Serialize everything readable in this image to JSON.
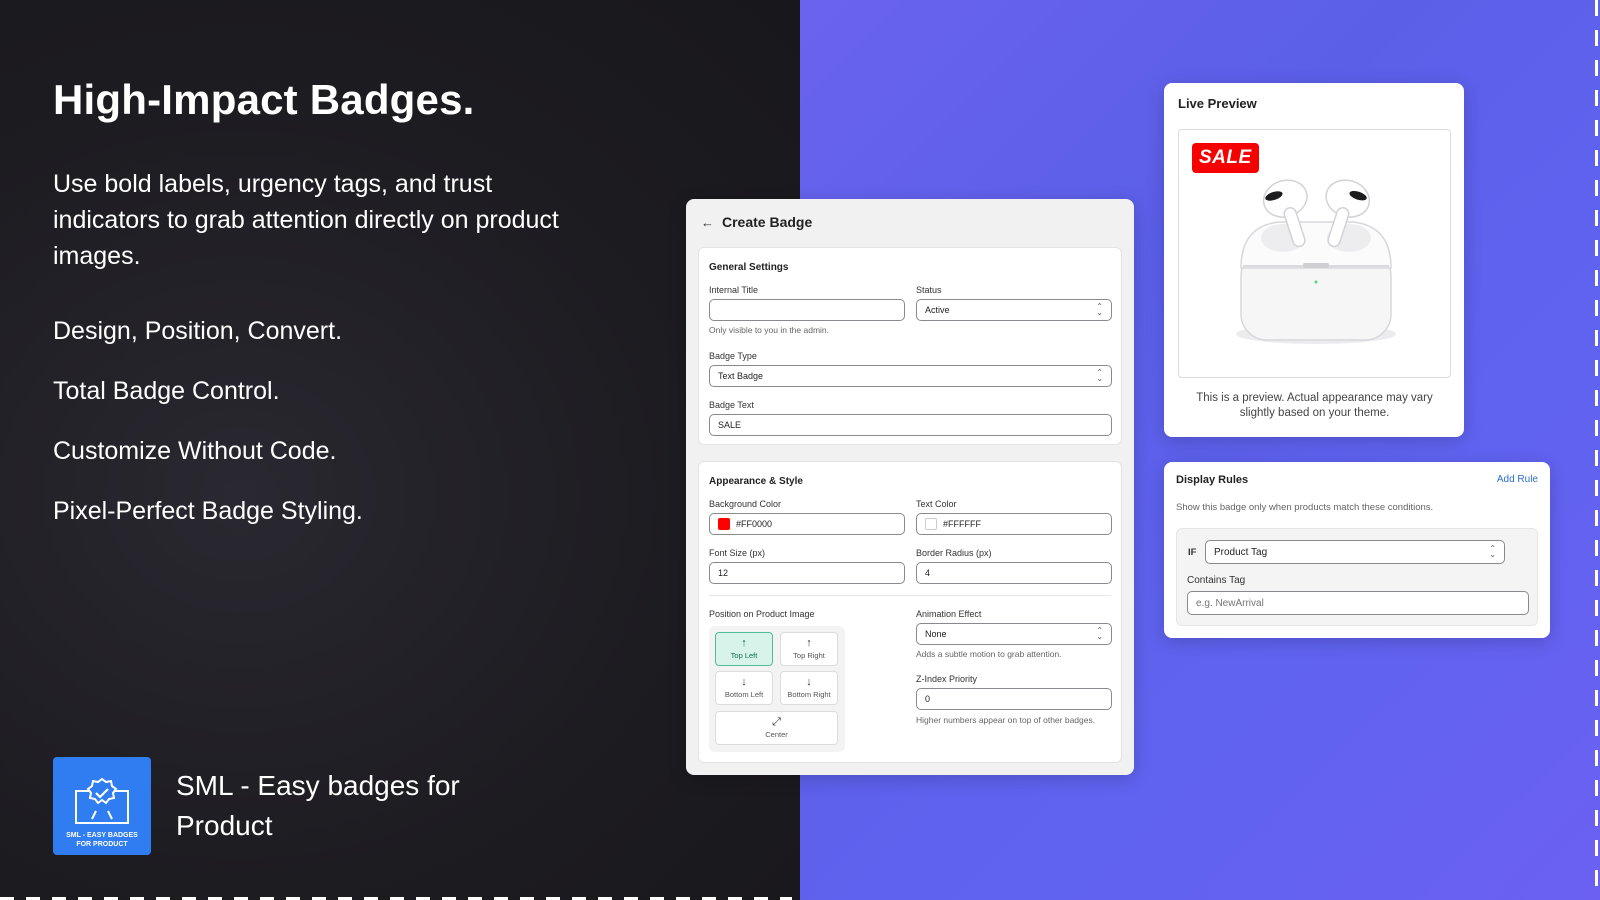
{
  "hero": {
    "title": "High-Impact Badges.",
    "description": "Use bold labels, urgency tags, and trust indicators to grab attention directly on product images.",
    "features": [
      "Design, Position, Convert.",
      "Total Badge Control.",
      "Customize Without Code.",
      "Pixel-Perfect Badge Styling."
    ]
  },
  "app": {
    "logo_text": "SML - EASY BADGES\nFOR PRODUCT",
    "name": "SML - Easy badges for Product",
    "brand_color": "#2f7df0"
  },
  "create_badge": {
    "back_icon": "arrow-left-icon",
    "title": "Create Badge",
    "general": {
      "title": "General Settings",
      "internal_title_label": "Internal Title",
      "internal_title_value": "",
      "internal_title_help": "Only visible to you in the admin.",
      "status_label": "Status",
      "status_value": "Active",
      "badge_type_label": "Badge Type",
      "badge_type_value": "Text Badge",
      "badge_text_label": "Badge Text",
      "badge_text_value": "SALE"
    },
    "appearance": {
      "title": "Appearance & Style",
      "bg_color_label": "Background Color",
      "bg_color_value": "#FF0000",
      "text_color_label": "Text Color",
      "text_color_value": "#FFFFFF",
      "font_size_label": "Font Size (px)",
      "font_size_value": "12",
      "border_radius_label": "Border Radius (px)",
      "border_radius_value": "4",
      "position_label": "Position on Product Image",
      "positions": {
        "top_left": "Top Left",
        "top_right": "Top Right",
        "bottom_left": "Bottom Left",
        "bottom_right": "Bottom Right",
        "center": "Center"
      },
      "selected_position": "Top Left",
      "animation_label": "Animation Effect",
      "animation_value": "None",
      "animation_help": "Adds a subtle motion to grab attention.",
      "zindex_label": "Z-Index Priority",
      "zindex_value": "0",
      "zindex_help": "Higher numbers appear on top of other badges."
    }
  },
  "live_preview": {
    "title": "Live Preview",
    "badge_text": "SALE",
    "badge_color": "#f70000",
    "note": "This is a preview. Actual appearance may vary slightly based on your theme."
  },
  "display_rules": {
    "title": "Display Rules",
    "add_rule": "Add Rule",
    "description": "Show this badge only when products match these conditions.",
    "if_label": "IF",
    "condition_value": "Product Tag",
    "contains_label": "Contains Tag",
    "contains_placeholder": "e.g. NewArrival"
  }
}
